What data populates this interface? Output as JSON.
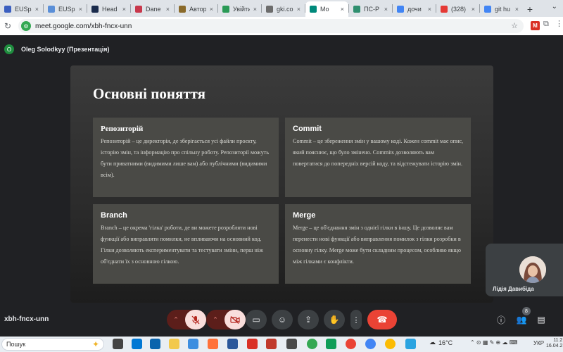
{
  "browser": {
    "tabs": [
      {
        "title": "EUSpa",
        "color": "#3b5fc0"
      },
      {
        "title": "EUSpa",
        "color": "#5a8fd8"
      },
      {
        "title": "Head",
        "color": "#1a2b4c"
      },
      {
        "title": "Dane",
        "color": "#c8384c"
      },
      {
        "title": "Автор",
        "color": "#8a6a2a"
      },
      {
        "title": "Увійти",
        "color": "#2a9a56"
      },
      {
        "title": "gki.co",
        "color": "#6c6c6c"
      },
      {
        "title": "Mo",
        "color": "#00897b",
        "active": true
      },
      {
        "title": "ПС-Р",
        "color": "#2f8f6f"
      },
      {
        "title": "дочи",
        "color": "#4285f4"
      },
      {
        "title": "(328)",
        "color": "#e53935"
      },
      {
        "title": "git hu",
        "color": "#4285f4"
      }
    ],
    "new_tab_label": "+",
    "url": "meet.google.com/xbh-fncx-unn",
    "ext_label": "M"
  },
  "presenter": {
    "avatar_letter": "O",
    "name": "Oleg Solodkyy (Презентація)"
  },
  "slide": {
    "title": "Основні поняття",
    "cards": [
      {
        "title": "Репозиторій",
        "body": "Репозиторій – це директорія, де зберігається усі файли проєкту, історію змін, та інформацію про спільну роботу. Репозиторії можуть бути приватними (видимими лише вам) або публічними (видимими всім)."
      },
      {
        "title": "Commit",
        "body": "Commit – це збереження змін у вашому коді. Кожен commit має опис, який пояснює, що було змінено. Commits дозволяють вам повертатися до попередніх версій коду, та відстежувати історію змін."
      },
      {
        "title": "Branch",
        "body": "Branch – це окрема 'гілка' роботи, де ви можете розробляти нові функції або виправляти помилки, не впливаючи на основний код. Гілки дозволяють експериментувати та тестувати зміни, перш ніж об'єднати їх з основною гілкою."
      },
      {
        "title": "Merge",
        "body": "Merge – це об'єднання змін з однієї гілки в іншу. Це дозволяє вам перенести нові функції або виправлення помилок з гілки розробки в основну гілку. Merge може бути складним процесом, особливо якщо між гілками є конфлікти."
      }
    ]
  },
  "participant": {
    "name": "Лідія Давибіда"
  },
  "meeting": {
    "code": "xbh-fncx-unn",
    "people_count": "8"
  },
  "taskbar": {
    "search_placeholder": "Пошук",
    "temperature": "16°C",
    "language": "УКР",
    "time": "11:2",
    "date": "16.04.2"
  },
  "icons": {
    "back": "back-arrow-icon",
    "reload": "reload-icon",
    "mic_off": "mic-off-icon",
    "cam_off": "camera-off-icon",
    "captions": "captions-icon",
    "emoji": "emoji-icon",
    "present": "present-screen-icon",
    "raise_hand": "raise-hand-icon",
    "more": "more-vert-icon",
    "end_call": "end-call-icon",
    "info": "info-icon",
    "people": "people-icon",
    "chat": "chat-icon"
  }
}
